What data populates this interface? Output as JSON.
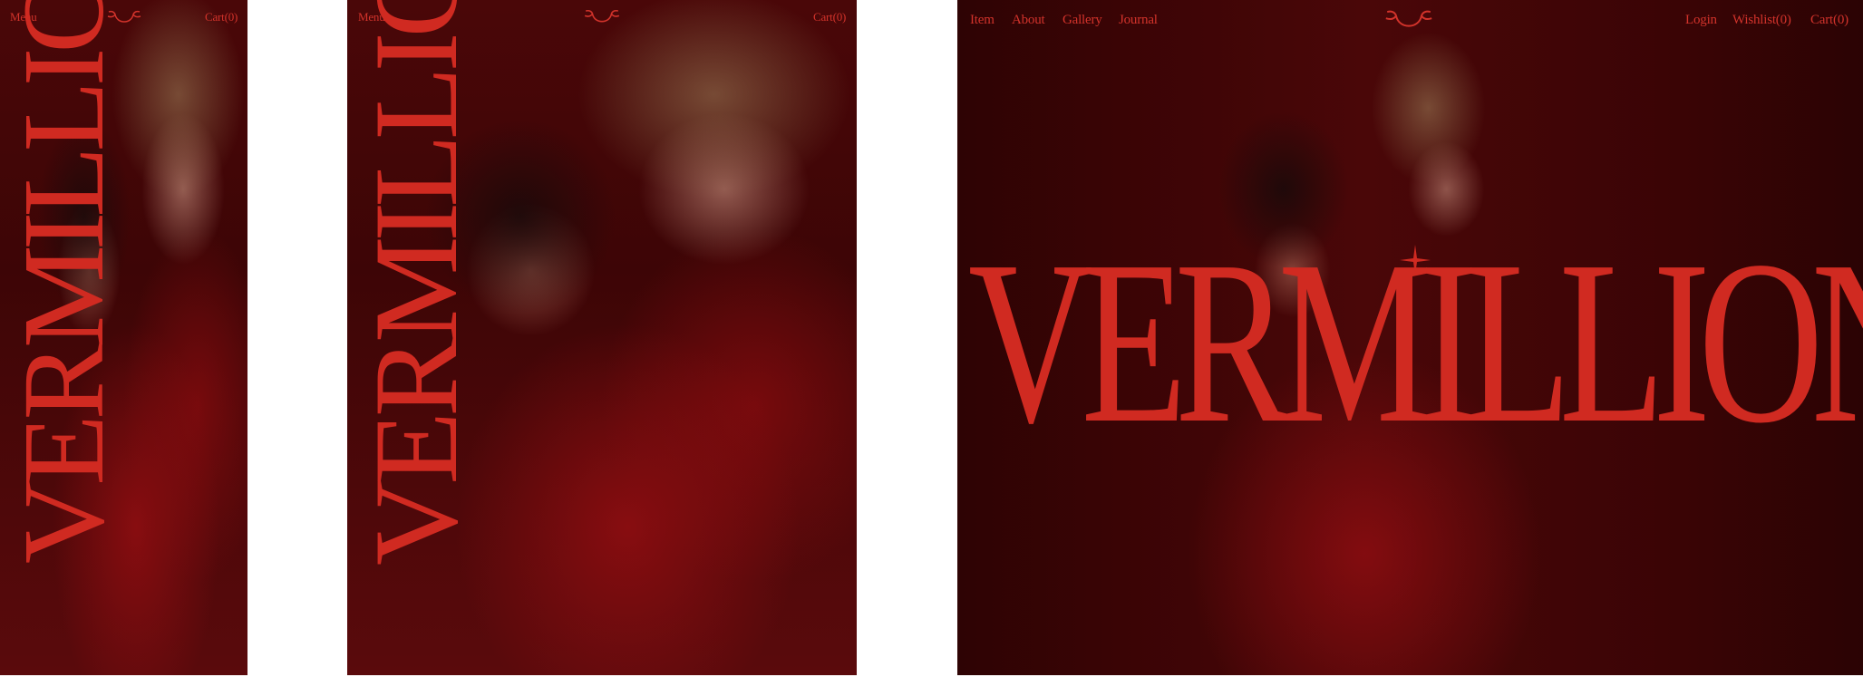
{
  "brand": {
    "wordmark": "VERMILLION",
    "accent_color": "#d02a21",
    "background_color": "#3a0606"
  },
  "mobile": {
    "menu_label": "Menu",
    "cart_label": "Cart(0)",
    "logo_icon": "horns-logo-icon"
  },
  "tablet": {
    "menu_label": "Menu",
    "cart_label": "Cart(0)",
    "logo_icon": "horns-logo-icon"
  },
  "desktop": {
    "nav_left": [
      "Item",
      "About",
      "Gallery",
      "Journal"
    ],
    "nav_right": [
      "Login",
      "Wishlist(0)",
      "Cart(0)"
    ],
    "logo_icon": "horns-logo-icon"
  }
}
